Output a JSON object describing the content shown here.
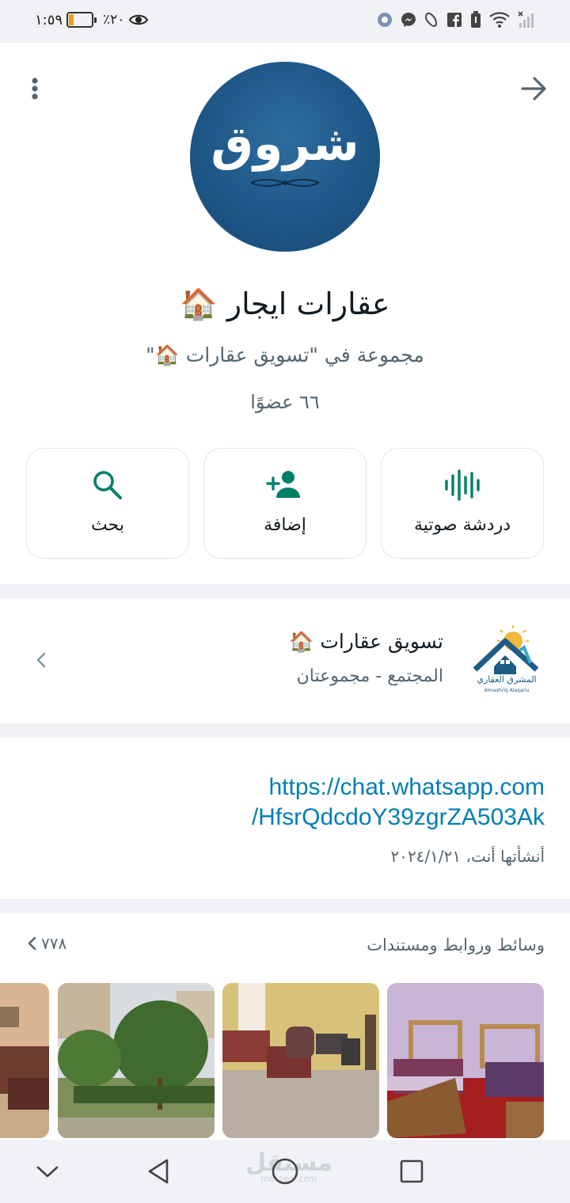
{
  "status_bar": {
    "time": "١:٥٩",
    "battery_percent": "٪٢٠",
    "battery_level": 0.2,
    "icons": [
      "eye-comfort-icon",
      "chrome-icon",
      "messenger-icon",
      "viber-icon",
      "facebook-icon",
      "battery-saver-icon",
      "wifi-icon",
      "signal-icon"
    ]
  },
  "header": {
    "avatar_text": "شروق",
    "group_name": "عقارات ايجار 🏠",
    "group_in": "مجموعة في \"تسويق عقارات 🏠\"",
    "members": "٦٦ عضوًا"
  },
  "actions": [
    {
      "label": "دردشة صوتية",
      "icon": "voice-chat-icon"
    },
    {
      "label": "إضافة",
      "icon": "add-person-icon"
    },
    {
      "label": "بحث",
      "icon": "search-icon"
    }
  ],
  "community": {
    "name": "تسويق عقارات 🏠",
    "subtitle": "المجتمع - مجموعتان",
    "logo_text": "المشرق العقاري",
    "logo_subtext": "Almashriq Alaqariu"
  },
  "invite": {
    "link_line1": "https://chat.whatsapp.com",
    "link_line2": "/HfsrQdcdoY39zgrZA503Ak",
    "created": "أنشأتها أنت، ٢٠٢٤/١/٢١"
  },
  "media": {
    "title": "وسائط وروابط ومستندات",
    "count": "٧٧٨",
    "thumbnails": [
      "bedroom-photo",
      "living-room-photo",
      "garden-photo",
      "sofa-photo"
    ]
  },
  "navbar": {
    "watermark": "مستقل",
    "watermark_sub": "mostaql.com"
  },
  "colors": {
    "accent_green": "#008069",
    "link_blue": "#027eb5",
    "avatar_blue": "#1d5585"
  }
}
